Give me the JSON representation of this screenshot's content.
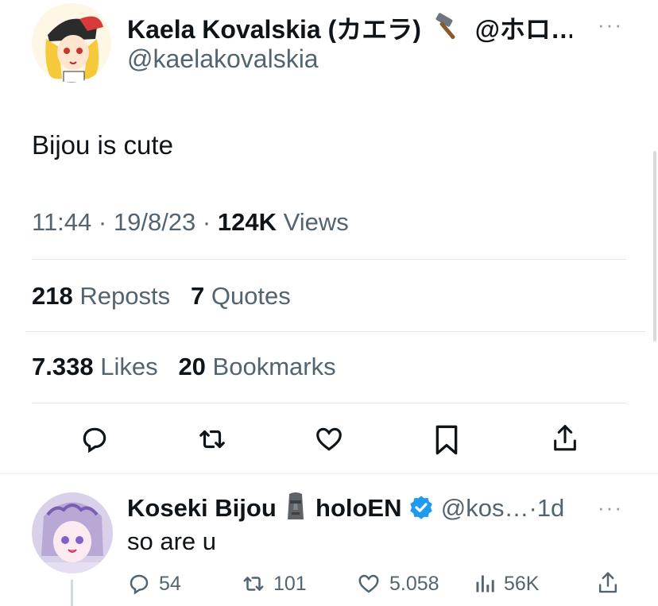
{
  "tweet": {
    "author_name": "Kaela Kovalskia (カエラ)",
    "author_name_suffix": "@ホロ…",
    "author_emoji": "hammer-icon",
    "handle": "@kaelakovalskia",
    "more": "···",
    "text": "Bijou is cute",
    "time": "11:44",
    "date": "19/8/23",
    "sep1": "·",
    "sep2": "·",
    "views_count": "124K",
    "views_label": "Views",
    "reposts_count": "218",
    "reposts_label": "Reposts",
    "quotes_count": "7",
    "quotes_label": "Quotes",
    "likes_count": "7.338",
    "likes_label": "Likes",
    "bookmarks_count": "20",
    "bookmarks_label": "Bookmarks",
    "actions": [
      "reply-icon",
      "repost-icon",
      "like-icon",
      "bookmark-icon",
      "share-icon"
    ]
  },
  "reply": {
    "author_name": "Koseki Bijou",
    "author_emoji": "moai-icon",
    "author_name_suffix": "holoEN",
    "verified": "verified-badge-icon",
    "handle": "@kos…",
    "sep": "·",
    "age": "1d",
    "more": "···",
    "text": "so are u",
    "reply_count": "54",
    "repost_count": "101",
    "like_count": "5.058",
    "view_count": "56K"
  },
  "colors": {
    "text": "#0f1419",
    "secondary": "#536471",
    "divider": "#e1e6ea",
    "verified": "#1d9bf0"
  }
}
